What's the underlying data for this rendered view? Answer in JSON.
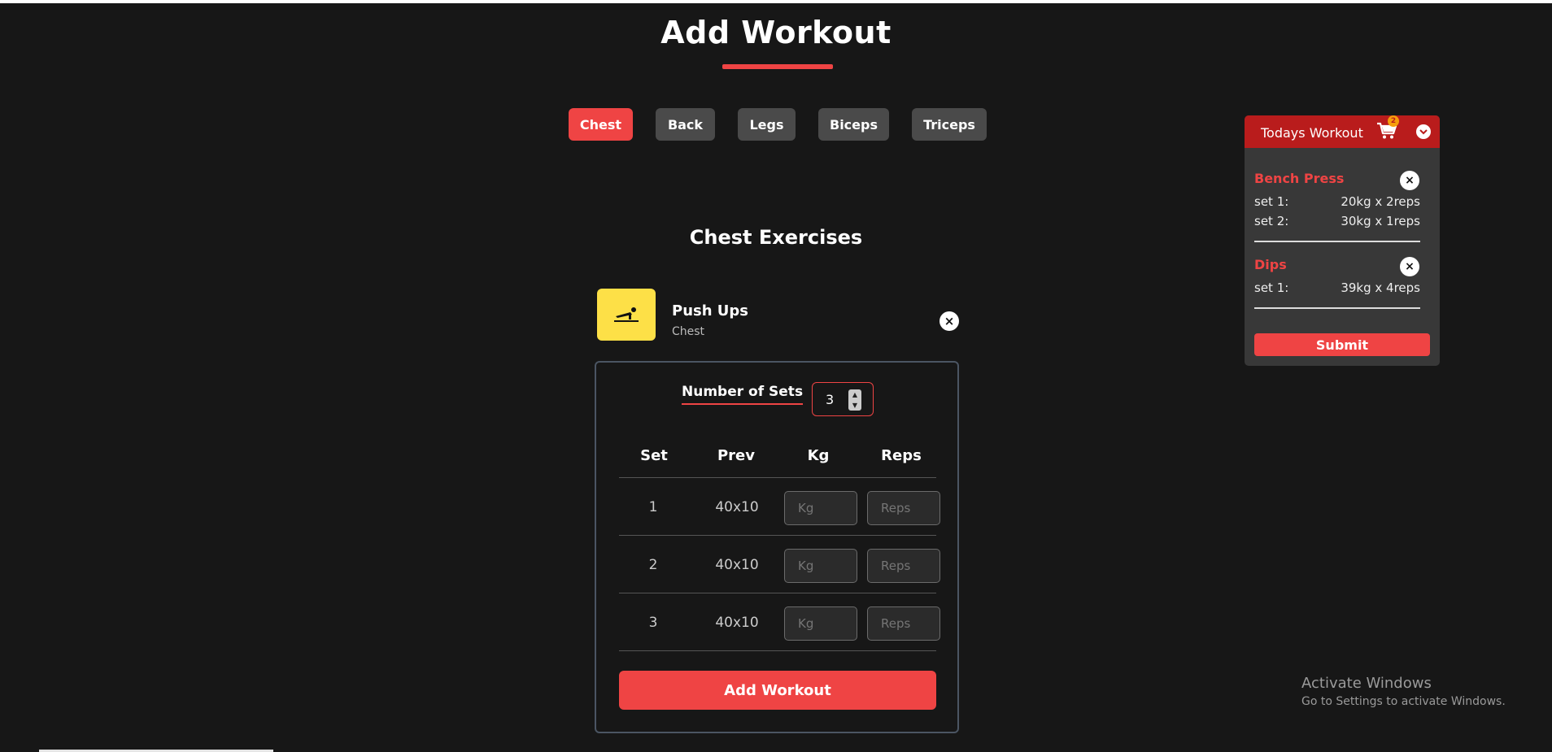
{
  "page": {
    "title": "Add Workout"
  },
  "tabs": [
    {
      "label": "Chest",
      "active": true
    },
    {
      "label": "Back",
      "active": false
    },
    {
      "label": "Legs",
      "active": false
    },
    {
      "label": "Biceps",
      "active": false
    },
    {
      "label": "Triceps",
      "active": false
    }
  ],
  "section": {
    "title": "Chest Exercises"
  },
  "exercise": {
    "name": "Push Ups",
    "category": "Chest",
    "icon": "push-up-icon",
    "remove_icon": "×",
    "sets_label": "Number of Sets",
    "sets_value": "3",
    "columns": [
      "Set",
      "Prev",
      "Kg",
      "Reps"
    ],
    "rows": [
      {
        "set": "1",
        "prev": "40x10",
        "kg_placeholder": "Kg",
        "reps_placeholder": "Reps"
      },
      {
        "set": "2",
        "prev": "40x10",
        "kg_placeholder": "Kg",
        "reps_placeholder": "Reps"
      },
      {
        "set": "3",
        "prev": "40x10",
        "kg_placeholder": "Kg",
        "reps_placeholder": "Reps"
      }
    ],
    "add_button": "Add Workout"
  },
  "today": {
    "title": "Todays Workout",
    "badge": "2",
    "workouts": [
      {
        "name": "Bench Press",
        "sets": [
          {
            "label": "set 1:",
            "value": "20kg x 2reps"
          },
          {
            "label": "set 2:",
            "value": "30kg x 1reps"
          }
        ]
      },
      {
        "name": "Dips",
        "sets": [
          {
            "label": "set 1:",
            "value": "39kg x 4reps"
          }
        ]
      }
    ],
    "remove_icon": "×",
    "submit": "Submit"
  },
  "watermark": {
    "line1": "Activate Windows",
    "line2": "Go to Settings to activate Windows."
  },
  "colors": {
    "accent": "#ef4444",
    "background": "#171717",
    "tab": "#4a4a4a",
    "icon_bg": "#fde047",
    "panel_head": "#b91c1c"
  }
}
